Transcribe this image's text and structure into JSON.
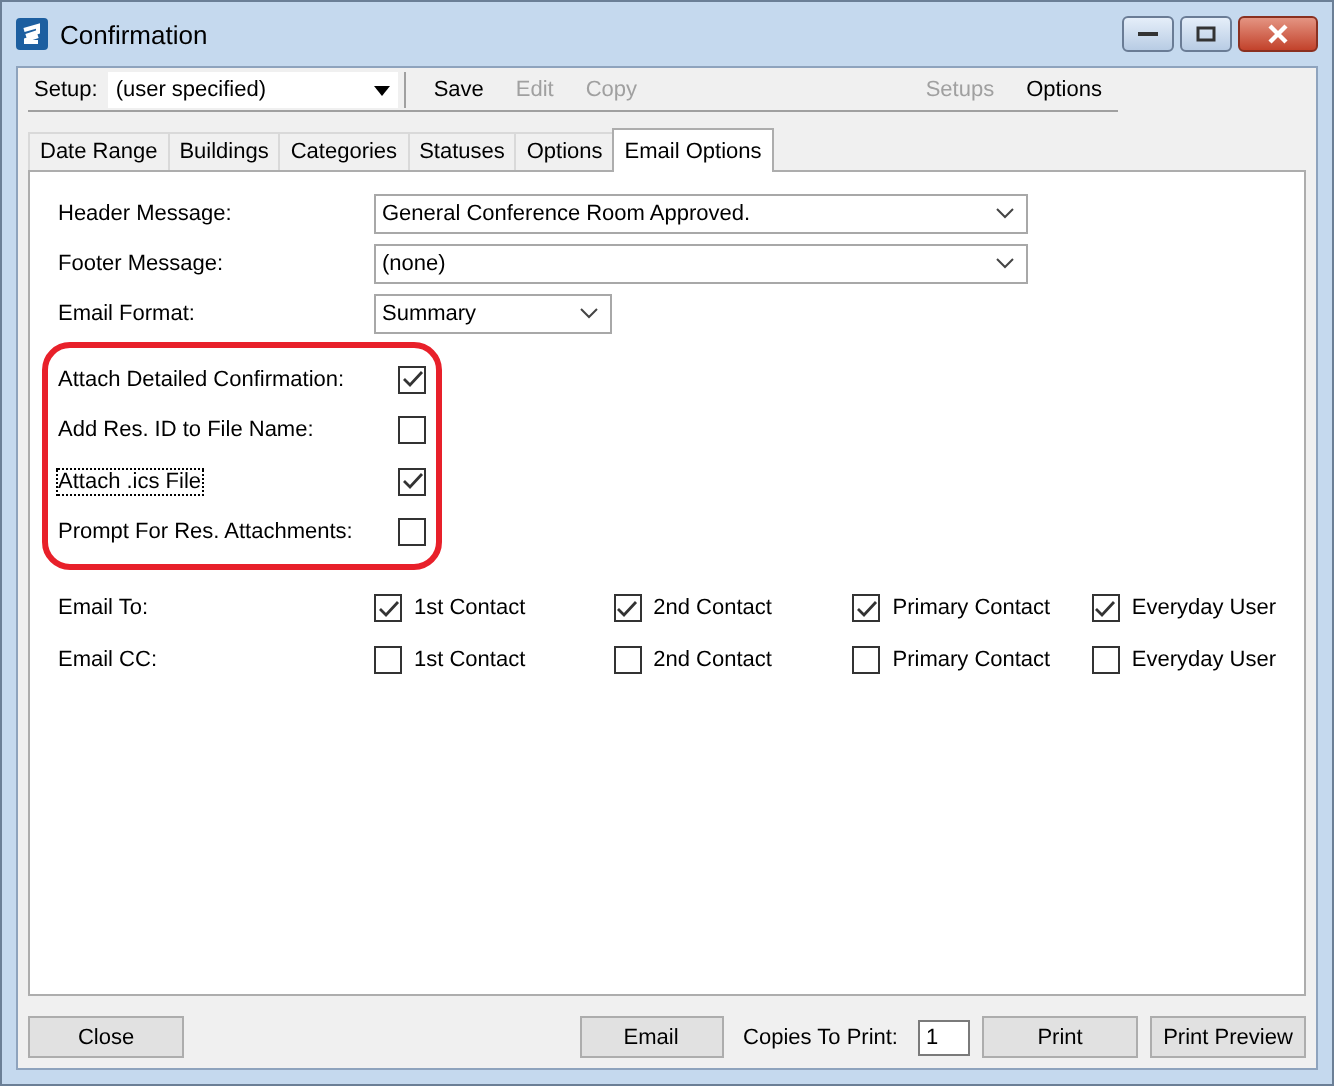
{
  "window": {
    "title": "Confirmation"
  },
  "toolbar": {
    "setup_label": "Setup:",
    "setup_value": "(user specified)",
    "actions": [
      {
        "label": "Save",
        "disabled": false
      },
      {
        "label": "Edit",
        "disabled": true
      },
      {
        "label": "Copy",
        "disabled": true
      }
    ],
    "right_actions": [
      {
        "label": "Setups",
        "disabled": true
      },
      {
        "label": "Options",
        "disabled": false
      }
    ]
  },
  "tabs": [
    {
      "label": "Date Range",
      "selected": false
    },
    {
      "label": "Buildings",
      "selected": false
    },
    {
      "label": "Categories",
      "selected": false
    },
    {
      "label": "Statuses",
      "selected": false
    },
    {
      "label": "Options",
      "selected": false
    },
    {
      "label": "Email Options",
      "selected": true
    }
  ],
  "fields": [
    {
      "label": "Header Message:",
      "value": "General Conference Room Approved.",
      "kind": "wide"
    },
    {
      "label": "Footer Message:",
      "value": "(none)",
      "kind": "wide"
    },
    {
      "label": "Email Format:",
      "value": "Summary",
      "kind": "narrow"
    }
  ],
  "attachments": [
    {
      "label": "Attach Detailed Confirmation:",
      "checked": true,
      "focused": false
    },
    {
      "label": "Add Res. ID to File Name:",
      "checked": false,
      "focused": false
    },
    {
      "label": "Attach .ics File",
      "checked": true,
      "focused": true
    },
    {
      "label": "Prompt For Res. Attachments:",
      "checked": false,
      "focused": false
    }
  ],
  "recipients": [
    {
      "label": "Email To:",
      "options": [
        {
          "label": "1st Contact",
          "checked": true
        },
        {
          "label": "2nd Contact",
          "checked": true
        },
        {
          "label": "Primary Contact",
          "checked": true
        },
        {
          "label": "Everyday User",
          "checked": true
        }
      ]
    },
    {
      "label": "Email CC:",
      "options": [
        {
          "label": "1st Contact",
          "checked": false
        },
        {
          "label": "2nd Contact",
          "checked": false
        },
        {
          "label": "Primary Contact",
          "checked": false
        },
        {
          "label": "Everyday User",
          "checked": false
        }
      ]
    }
  ],
  "footer": {
    "close": "Close",
    "email": "Email",
    "copies_label": "Copies To Print:",
    "copies_value": "1",
    "print": "Print",
    "print_preview": "Print Preview"
  }
}
